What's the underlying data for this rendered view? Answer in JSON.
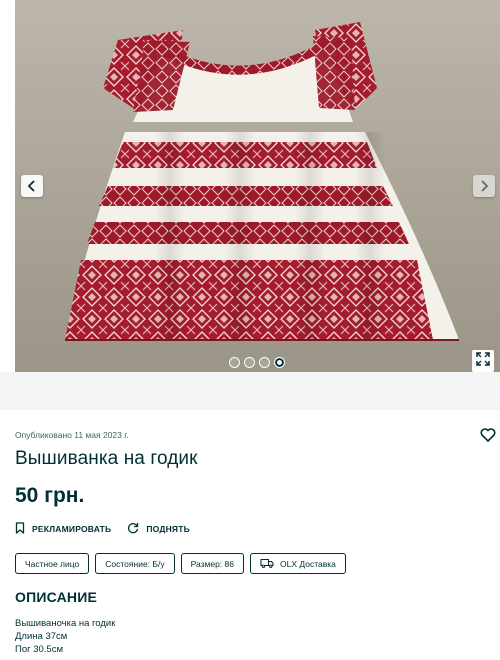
{
  "listing": {
    "published": "Опубликовано 11 мая 2023 г.",
    "title": "Вышиванка на годик",
    "price": "50 грн.",
    "promote_label": "РЕКЛАМИРОВАТЬ",
    "raise_label": "ПОДНЯТЬ"
  },
  "gallery": {
    "photo_count": 4,
    "active_photo": 4
  },
  "tags": [
    {
      "label": "Частное лицо"
    },
    {
      "label": "Состояние: Б/у"
    },
    {
      "label": "Размер: 86"
    },
    {
      "label": "OLX Доставка",
      "icon": "delivery-truck-icon"
    }
  ],
  "description": {
    "heading": "ОПИСАНИЕ",
    "lines": [
      "Вышиваночка на годик",
      "Длина 37см",
      "Пог 30.5см"
    ]
  },
  "icons": {
    "prev": "chevron-left-icon",
    "next": "chevron-right-icon",
    "expand": "expand-icon",
    "favorite": "heart-icon",
    "promote": "bookmark-flag-icon",
    "raise": "refresh-icon"
  },
  "colors": {
    "text": "#002f34",
    "embroidery_red": "#a51c2e",
    "fabric_white": "#f4f1ea",
    "divider_bg": "#f2f4f5"
  }
}
